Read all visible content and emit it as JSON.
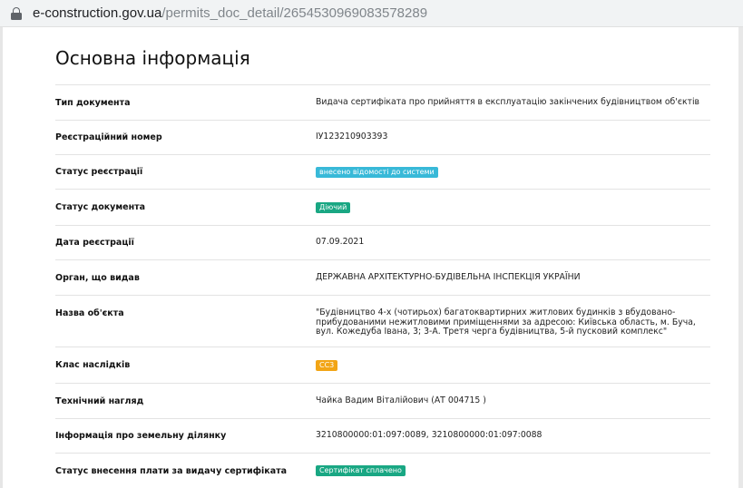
{
  "browser": {
    "url_domain": "e-construction.gov.ua",
    "url_path": "/permits_doc_detail/2654530969083578289",
    "lock_icon": "lock-icon"
  },
  "page": {
    "title": "Основна інформація"
  },
  "rows": [
    {
      "label": "Тип документа",
      "value": "Видача сертифіката про прийняття в експлуатацію закінчених будівництвом об'єктів"
    },
    {
      "label": "Реєстраційний номер",
      "value": "ІУ123210903393"
    },
    {
      "label": "Статус реєстрації",
      "value": "внесено відомості до системи",
      "badge_color": "#38b9d8"
    },
    {
      "label": "Статус документа",
      "value": "Діючий",
      "badge_color": "#19a783"
    },
    {
      "label": "Дата реєстрації",
      "value": "07.09.2021"
    },
    {
      "label": "Орган, що видав",
      "value": "ДЕРЖАВНА АРХІТЕКТУРНО-БУДІВЕЛЬНА ІНСПЕКЦІЯ УКРАЇНИ"
    },
    {
      "label": "Назва об'єкта",
      "value": "\"Будівництво 4-х (чотирьох) багатоквартирних житлових будинків з вбудовано-прибудованими нежитловими приміщеннями за адресою: Київська область, м. Буча, вул. Кожедуба Івана, 3; 3-А. Третя черга будівництва, 5-й пусковий комплекс\""
    },
    {
      "label": "Клас наслідків",
      "value": "СС3",
      "badge_color": "#f2a516"
    },
    {
      "label": "Технічний нагляд",
      "value": "Чайка Вадим Віталійович (АТ 004715 )"
    },
    {
      "label": "Інформація про земельну ділянку",
      "value": "3210800000:01:097:0089, 3210800000:01:097:0088"
    },
    {
      "label": "Статус внесення плати за видачу сертифіката",
      "value": "Сертифікат сплачено",
      "badge_color": "#19a783"
    }
  ]
}
